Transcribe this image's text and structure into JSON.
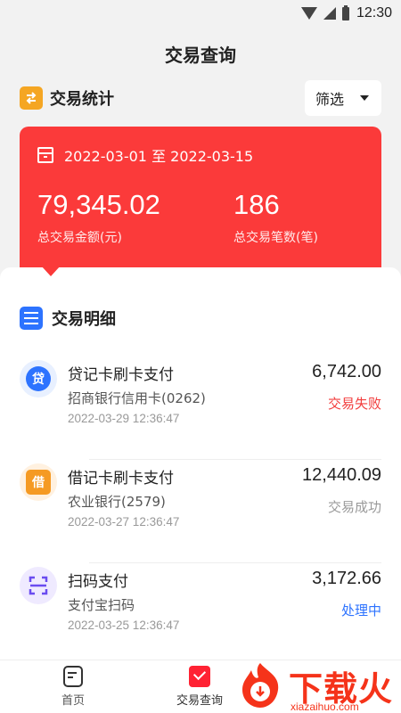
{
  "status_bar": {
    "time": "12:30"
  },
  "page_title": "交易查询",
  "stats": {
    "title": "交易统计",
    "filter_label": "筛选",
    "date_range": "2022-03-01 至 2022-03-15",
    "total_amount": "79,345.02",
    "total_amount_label": "总交易金额(元)",
    "total_count": "186",
    "total_count_label": "总交易笔数(笔)"
  },
  "details": {
    "title": "交易明细",
    "transactions": [
      {
        "icon_char": "贷",
        "title": "贷记卡刷卡支付",
        "sub": "招商银行信用卡(0262)",
        "time": "2022-03-29 12:36:47",
        "amount": "6,742.00",
        "status": "交易失败",
        "status_color": "#f23c3c",
        "icon": "credit-card-icon"
      },
      {
        "icon_char": "借",
        "title": "借记卡刷卡支付",
        "sub": "农业银行(2579)",
        "time": "2022-03-27 12:36:47",
        "amount": "12,440.09",
        "status": "交易成功",
        "status_color": "#999999",
        "icon": "debit-card-icon"
      },
      {
        "icon_char": "",
        "title": "扫码支付",
        "sub": "支付宝扫码",
        "time": "2022-03-25 12:36:47",
        "amount": "3,172.66",
        "status": "处理中",
        "status_color": "#2d73ff",
        "icon": "scan-icon"
      }
    ]
  },
  "tabbar": {
    "home_label": "首页",
    "query_label": "交易查询"
  },
  "watermark": {
    "text": "下载火",
    "sub": "xiazaihuo.com"
  },
  "colors": {
    "accent_red": "#fb3a3a",
    "link_blue": "#2d73ff",
    "orange": "#f5a623"
  }
}
